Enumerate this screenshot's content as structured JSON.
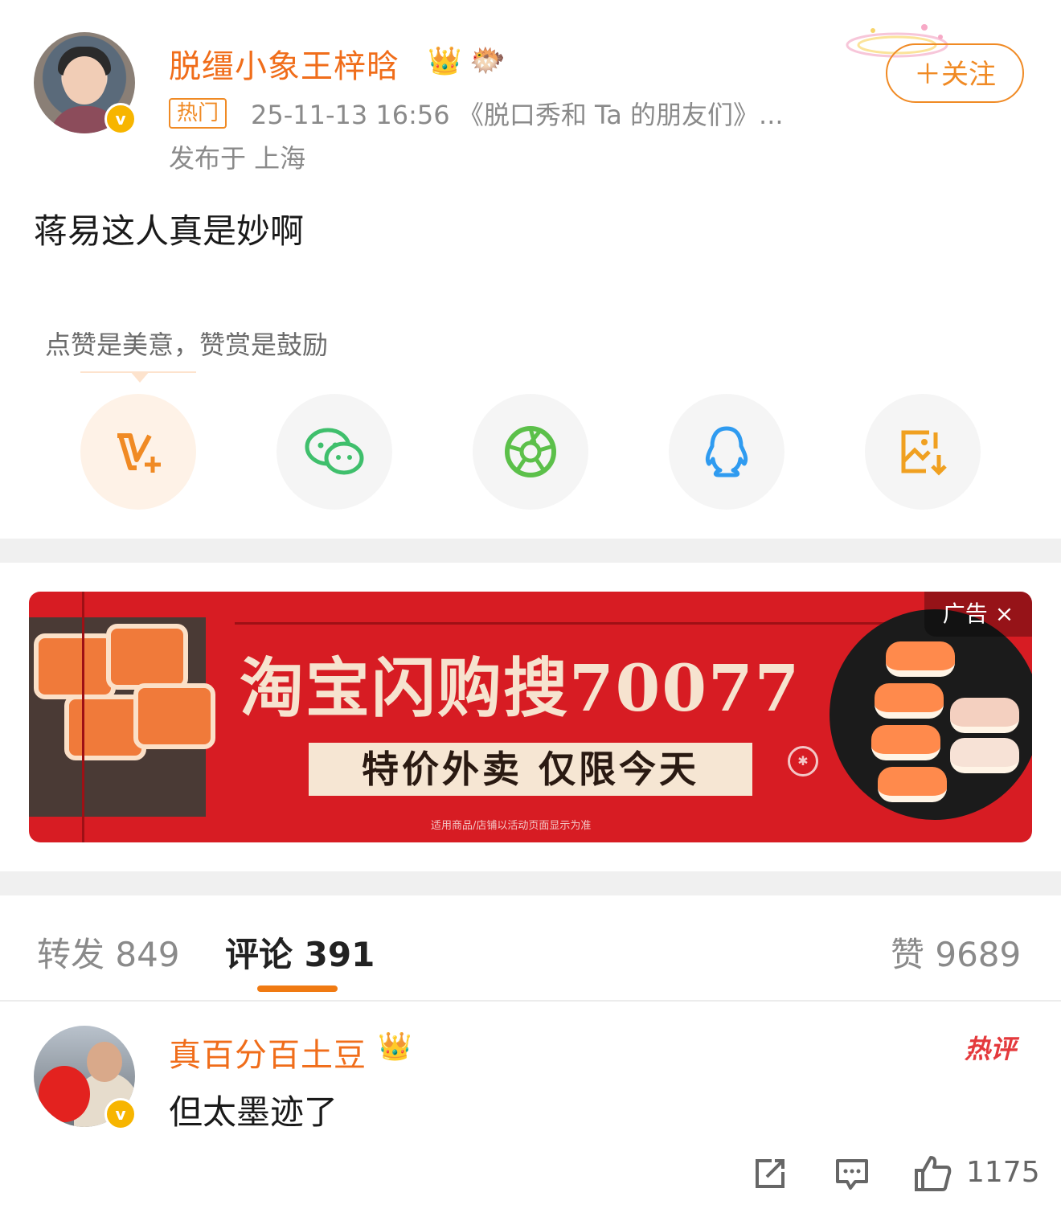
{
  "post": {
    "username": "脱缰小象王梓晗",
    "hot_tag": "热门",
    "meta": "25-11-13 16:56 《脱口秀和 Ta 的朋友们》...",
    "location": "发布于 上海",
    "follow_label": "＋关注",
    "content": "蒋易这人真是妙啊",
    "verified_mark": "v"
  },
  "share": {
    "tip": "点赞是美意，赞赏是鼓励",
    "items": [
      {
        "icon": "reward-v-plus-icon",
        "color": "#f08a24"
      },
      {
        "icon": "wechat-icon",
        "color": "#3fbf6c"
      },
      {
        "icon": "moments-aperture-icon",
        "color": "#5cc04a"
      },
      {
        "icon": "qq-penguin-icon",
        "color": "#2f9bf0"
      },
      {
        "icon": "save-image-icon",
        "color": "#f0a020"
      }
    ]
  },
  "ad": {
    "title": "淘宝闪购搜70077",
    "subtitle": "特价外卖  仅限今天",
    "fine_print": "适用商品/店铺以活动页面显示为准",
    "label": "广告",
    "close": "×"
  },
  "tabs": {
    "repost": "转发 849",
    "comment": "评论 391",
    "like": "赞 9689"
  },
  "comment": {
    "username": "真百分百土豆",
    "text": "但太墨迹了",
    "hot_label": "热评",
    "like_count": "1175",
    "verified_mark": "v"
  },
  "colors": {
    "accent": "#f06d1a",
    "ad_red": "#d71c23",
    "tab_underline": "#f07a12"
  }
}
